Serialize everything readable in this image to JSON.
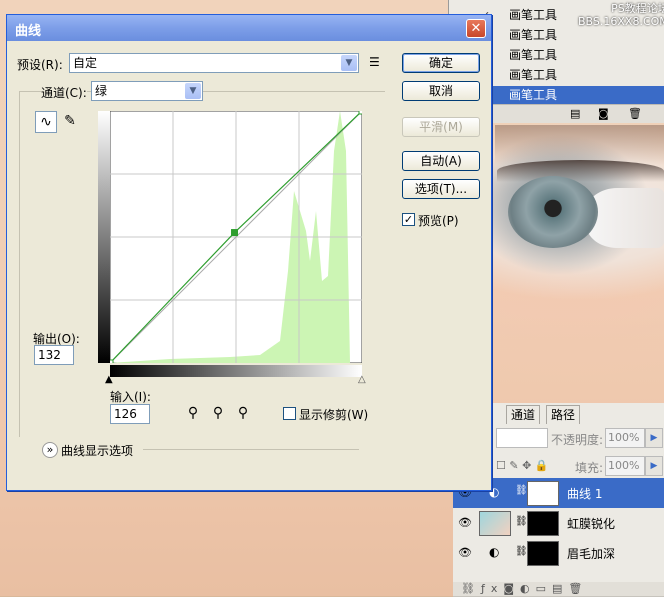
{
  "dialog": {
    "title": "曲线",
    "preset_label": "预设(R):",
    "preset_value": "自定",
    "channel_label": "通道(C):",
    "channel_value": "绿",
    "output_label": "输出(O):",
    "output_value": "132",
    "input_label": "输入(I):",
    "input_value": "126",
    "show_clipping_label": "显示修剪(W)",
    "curve_options_label": "曲线显示选项",
    "preview_label": "预览(P)",
    "preview_checked": true,
    "buttons": {
      "ok": "确定",
      "cancel": "取消",
      "smooth": "平滑(M)",
      "auto": "自动(A)",
      "options": "选项(T)..."
    }
  },
  "chart_data": {
    "type": "line",
    "series": [
      {
        "values": [
          [
            0,
            0
          ],
          [
            126,
            132
          ],
          [
            255,
            255
          ]
        ]
      }
    ],
    "histogram_color": "#ccf5b4",
    "curve_color": "#2e9e2e",
    "xlim": [
      0,
      255
    ],
    "ylim": [
      0,
      255
    ],
    "grid": true
  },
  "history": {
    "items": [
      {
        "label": "画笔工具",
        "selected": false
      },
      {
        "label": "画笔工具",
        "selected": false
      },
      {
        "label": "画笔工具",
        "selected": false
      },
      {
        "label": "画笔工具",
        "selected": false
      },
      {
        "label": "画笔工具",
        "selected": true
      }
    ]
  },
  "watermark": {
    "line1": "PS教程论坛",
    "line2": "BBS.16XX8.COM"
  },
  "layers_panel": {
    "tabs": [
      "通道",
      "路径"
    ],
    "opacity_label": "不透明度:",
    "opacity_value": "100%",
    "fill_label": "填充:",
    "fill_value": "100%",
    "layers": [
      {
        "name": "曲线 1",
        "selected": true
      },
      {
        "name": "虹膜锐化",
        "selected": false
      },
      {
        "name": "眉毛加深",
        "selected": false
      }
    ]
  },
  "colors": {
    "title_bar": "#7d9ee8",
    "selection": "#3a6bc7"
  }
}
